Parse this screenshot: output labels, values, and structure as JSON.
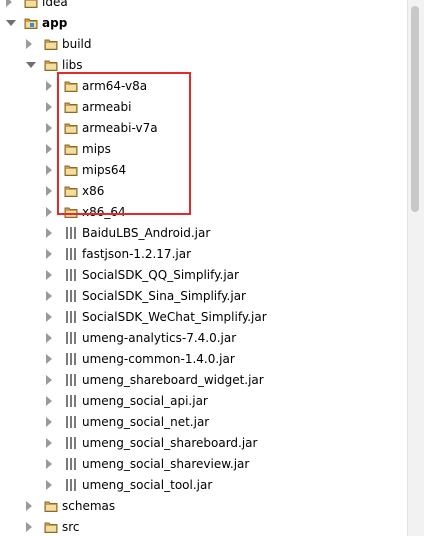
{
  "project_tree": {
    "nodes": [
      {
        "label": "idea",
        "type": "folder",
        "state": "collapsed",
        "depth": 1,
        "bold": false
      },
      {
        "label": "app",
        "type": "module",
        "state": "expanded",
        "depth": 1,
        "bold": true
      },
      {
        "label": "build",
        "type": "folder",
        "state": "collapsed",
        "depth": 2,
        "bold": false
      },
      {
        "label": "libs",
        "type": "folder",
        "state": "expanded",
        "depth": 2,
        "bold": false
      },
      {
        "label": "arm64-v8a",
        "type": "folder",
        "state": "collapsed",
        "depth": 3,
        "bold": false
      },
      {
        "label": "armeabi",
        "type": "folder",
        "state": "collapsed",
        "depth": 3,
        "bold": false
      },
      {
        "label": "armeabi-v7a",
        "type": "folder",
        "state": "collapsed",
        "depth": 3,
        "bold": false
      },
      {
        "label": "mips",
        "type": "folder",
        "state": "collapsed",
        "depth": 3,
        "bold": false
      },
      {
        "label": "mips64",
        "type": "folder",
        "state": "collapsed",
        "depth": 3,
        "bold": false
      },
      {
        "label": "x86",
        "type": "folder",
        "state": "collapsed",
        "depth": 3,
        "bold": false
      },
      {
        "label": "x86_64",
        "type": "folder",
        "state": "collapsed",
        "depth": 3,
        "bold": false
      },
      {
        "label": "BaiduLBS_Android.jar",
        "type": "jar",
        "state": "collapsed",
        "depth": 3,
        "bold": false
      },
      {
        "label": "fastjson-1.2.17.jar",
        "type": "jar",
        "state": "collapsed",
        "depth": 3,
        "bold": false
      },
      {
        "label": "SocialSDK_QQ_Simplify.jar",
        "type": "jar",
        "state": "collapsed",
        "depth": 3,
        "bold": false
      },
      {
        "label": "SocialSDK_Sina_Simplify.jar",
        "type": "jar",
        "state": "collapsed",
        "depth": 3,
        "bold": false
      },
      {
        "label": "SocialSDK_WeChat_Simplify.jar",
        "type": "jar",
        "state": "collapsed",
        "depth": 3,
        "bold": false
      },
      {
        "label": "umeng-analytics-7.4.0.jar",
        "type": "jar",
        "state": "collapsed",
        "depth": 3,
        "bold": false
      },
      {
        "label": "umeng-common-1.4.0.jar",
        "type": "jar",
        "state": "collapsed",
        "depth": 3,
        "bold": false
      },
      {
        "label": "umeng_shareboard_widget.jar",
        "type": "jar",
        "state": "collapsed",
        "depth": 3,
        "bold": false
      },
      {
        "label": "umeng_social_api.jar",
        "type": "jar",
        "state": "collapsed",
        "depth": 3,
        "bold": false
      },
      {
        "label": "umeng_social_net.jar",
        "type": "jar",
        "state": "collapsed",
        "depth": 3,
        "bold": false
      },
      {
        "label": "umeng_social_shareboard.jar",
        "type": "jar",
        "state": "collapsed",
        "depth": 3,
        "bold": false
      },
      {
        "label": "umeng_social_shareview.jar",
        "type": "jar",
        "state": "collapsed",
        "depth": 3,
        "bold": false
      },
      {
        "label": "umeng_social_tool.jar",
        "type": "jar",
        "state": "collapsed",
        "depth": 3,
        "bold": false
      },
      {
        "label": "schemas",
        "type": "folder",
        "state": "collapsed",
        "depth": 2,
        "bold": false
      },
      {
        "label": "src",
        "type": "folder",
        "state": "collapsed",
        "depth": 2,
        "bold": false
      }
    ]
  },
  "highlight": {
    "color": "#e8282b",
    "covers": [
      "arm64-v8a",
      "armeabi",
      "armeabi-v7a",
      "mips",
      "mips64",
      "x86",
      "x86_64"
    ]
  },
  "colors": {
    "folder_fill": "#c8a050",
    "folder_stroke": "#8a6a2a",
    "jar_bars": "#7a7a7a",
    "module_accent": "#3a8dd8"
  },
  "icons": {
    "folder": "folder-icon",
    "module": "module-folder-icon",
    "jar": "jar-library-icon",
    "collapsed": "collapsed-arrow-icon",
    "expanded": "expanded-arrow-icon"
  }
}
